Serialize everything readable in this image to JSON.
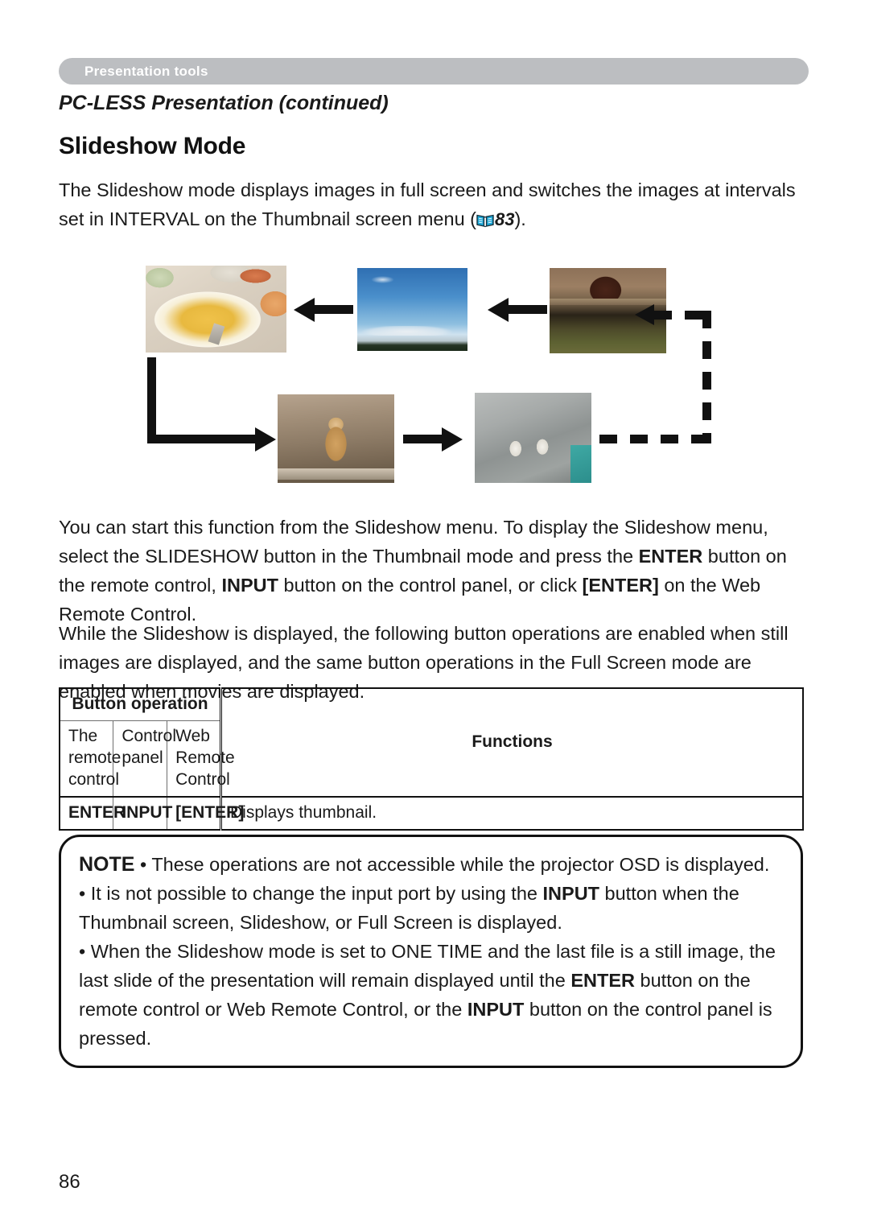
{
  "header": {
    "running_label": "Presentation tools",
    "bar_color": "#bcbec1",
    "bar_text_color": "#ffffff"
  },
  "section": {
    "title": "PC-LESS Presentation (continued)"
  },
  "heading": {
    "title": "Slideshow Mode"
  },
  "intro": {
    "line1": "The Slideshow mode displays images in full screen and switches the images at",
    "line2_before_ref": "intervals set in INTERVAL on the Thumbnail screen menu (",
    "book_icon": "book-icon",
    "book_icon_color": "#1aa7d8",
    "page_ref": "83",
    "line2_after_ref": ")."
  },
  "diagram": {
    "name": "slideshow-cycle-diagram",
    "images": [
      {
        "id": "food",
        "alt": "food-plates-photo"
      },
      {
        "id": "sky",
        "alt": "blue-sky-mountains-photo"
      },
      {
        "id": "panda",
        "alt": "red-panda-enclosure-photo"
      },
      {
        "id": "lion",
        "alt": "lion-photo"
      },
      {
        "id": "penguin",
        "alt": "penguins-on-rocks-photo"
      }
    ],
    "arrows": [
      {
        "id": "arrow-sky-to-food",
        "direction": "left"
      },
      {
        "id": "arrow-panda-to-sky",
        "direction": "left"
      },
      {
        "id": "arrow-food-to-lion",
        "direction": "elbow-down-right"
      },
      {
        "id": "arrow-lion-to-penguin",
        "direction": "right"
      },
      {
        "id": "arrow-penguin-to-panda",
        "direction": "dashed-loop-left"
      }
    ]
  },
  "paragraphs": {
    "start": {
      "seg1": "You can start this function from the Slideshow menu. To display the Slideshow menu, select the SLIDESHOW button in the Thumbnail mode and press the ",
      "b1": "ENTER",
      "seg2": " button on the remote control, ",
      "b2": "INPUT",
      "seg3": " button on the control panel, or click ",
      "b3": "[ENTER]",
      "seg4": " on the Web Remote Control."
    },
    "while": {
      "text": "While the Slideshow is displayed, the following button operations are enabled when still images are displayed, and the same button operations in the Full Screen mode are enabled when movies are displayed."
    }
  },
  "table": {
    "group_header": "Button operation",
    "functions_header": "Functions",
    "subheaders": [
      "The remote control",
      "Control panel",
      "Web Remote Control"
    ],
    "rows": [
      {
        "remote": "ENTER",
        "panel": "INPUT",
        "web": "[ENTER]",
        "function": "Displays thumbnail."
      }
    ]
  },
  "note": {
    "label": "NOTE",
    "bullet1": {
      "seg1": " • These operations are not accessible while the projector OSD is displayed."
    },
    "bullet2": {
      "seg1": "• It is not possible to change the input port by using the ",
      "b1": "INPUT",
      "seg2": " button when the Thumbnail screen, Slideshow, or Full Screen is displayed."
    },
    "bullet3": {
      "seg1": "• When the Slideshow mode is set to ONE TIME and the last file is a still image, the last slide of the presentation will remain displayed until the ",
      "b1": "ENTER",
      "seg2": " button on the remote control or Web Remote Control, or the ",
      "b2": "INPUT",
      "seg3": " button on the control panel is pressed."
    }
  },
  "footer": {
    "page_number": "86"
  }
}
